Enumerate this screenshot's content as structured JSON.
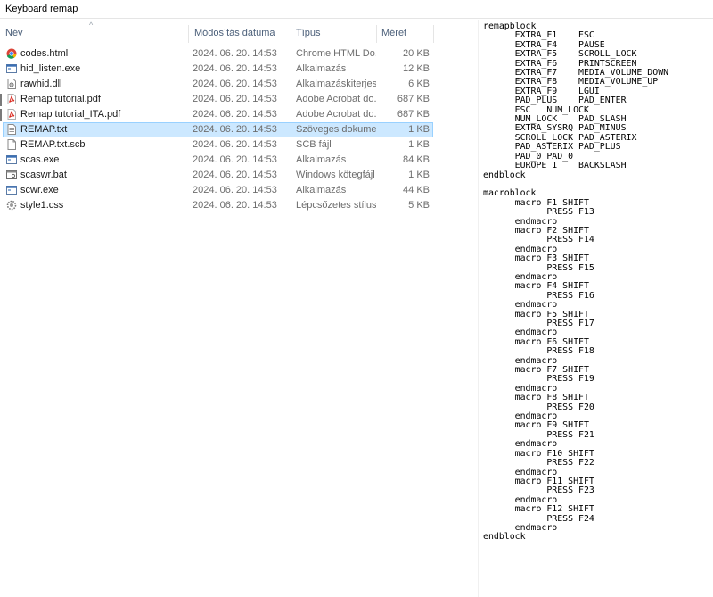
{
  "window": {
    "title": "Keyboard remap"
  },
  "columns": {
    "name": "Név",
    "date": "Módosítás dátuma",
    "type": "Típus",
    "size": "Méret"
  },
  "files": [
    {
      "name": "codes.html",
      "date": "2024. 06. 20. 14:53",
      "type": "Chrome HTML Do...",
      "size": "20 KB",
      "icon": "chrome-icon"
    },
    {
      "name": "hid_listen.exe",
      "date": "2024. 06. 20. 14:53",
      "type": "Alkalmazás",
      "size": "12 KB",
      "icon": "exe-icon"
    },
    {
      "name": "rawhid.dll",
      "date": "2024. 06. 20. 14:53",
      "type": "Alkalmazáskiterjes...",
      "size": "6 KB",
      "icon": "dll-icon"
    },
    {
      "name": "Remap tutorial.pdf",
      "date": "2024. 06. 20. 14:53",
      "type": "Adobe Acrobat do...",
      "size": "687 KB",
      "icon": "pdf-icon"
    },
    {
      "name": "Remap tutorial_ITA.pdf",
      "date": "2024. 06. 20. 14:53",
      "type": "Adobe Acrobat do...",
      "size": "687 KB",
      "icon": "pdf-icon"
    },
    {
      "name": "REMAP.txt",
      "date": "2024. 06. 20. 14:53",
      "type": "Szöveges dokume...",
      "size": "1 KB",
      "icon": "text-file-icon"
    },
    {
      "name": "REMAP.txt.scb",
      "date": "2024. 06. 20. 14:53",
      "type": "SCB fájl",
      "size": "1 KB",
      "icon": "blank-file-icon"
    },
    {
      "name": "scas.exe",
      "date": "2024. 06. 20. 14:53",
      "type": "Alkalmazás",
      "size": "84 KB",
      "icon": "exe-icon"
    },
    {
      "name": "scaswr.bat",
      "date": "2024. 06. 20. 14:53",
      "type": "Windows kötegfájl",
      "size": "1 KB",
      "icon": "batch-file-icon"
    },
    {
      "name": "scwr.exe",
      "date": "2024. 06. 20. 14:53",
      "type": "Alkalmazás",
      "size": "44 KB",
      "icon": "exe-icon"
    },
    {
      "name": "style1.css",
      "date": "2024. 06. 20. 14:53",
      "type": "Lépcsőzetes stílusl...",
      "size": "5 KB",
      "icon": "css-file-icon"
    }
  ],
  "selected_file": "REMAP.txt",
  "preview": {
    "text": "remapblock\n      EXTRA_F1    ESC\n      EXTRA_F4    PAUSE\n      EXTRA_F5    SCROLL_LOCK\n      EXTRA_F6    PRINTSCREEN\n      EXTRA_F7    MEDIA_VOLUME_DOWN\n      EXTRA_F8    MEDIA_VOLUME_UP\n      EXTRA_F9    LGUI\n      PAD_PLUS    PAD_ENTER\n      ESC   NUM_LOCK\n      NUM_LOCK    PAD_SLASH\n      EXTRA_SYSRQ PAD_MINUS\n      SCROLL_LOCK PAD_ASTERIX\n      PAD_ASTERIX PAD_PLUS\n      PAD_0 PAD_0\n      EUROPE_1    BACKSLASH\nendblock\n\nmacroblock\n      macro F1 SHIFT\n            PRESS F13\n      endmacro\n      macro F2 SHIFT\n            PRESS F14\n      endmacro\n      macro F3 SHIFT\n            PRESS F15\n      endmacro\n      macro F4 SHIFT\n            PRESS F16\n      endmacro\n      macro F5 SHIFT\n            PRESS F17\n      endmacro\n      macro F6 SHIFT\n            PRESS F18\n      endmacro\n      macro F7 SHIFT\n            PRESS F19\n      endmacro\n      macro F8 SHIFT\n            PRESS F20\n      endmacro\n      macro F9 SHIFT\n            PRESS F21\n      endmacro\n      macro F10 SHIFT\n            PRESS F22\n      endmacro\n      macro F11 SHIFT\n            PRESS F23\n      endmacro\n      macro F12 SHIFT\n            PRESS F24\n      endmacro\nendblock"
  }
}
